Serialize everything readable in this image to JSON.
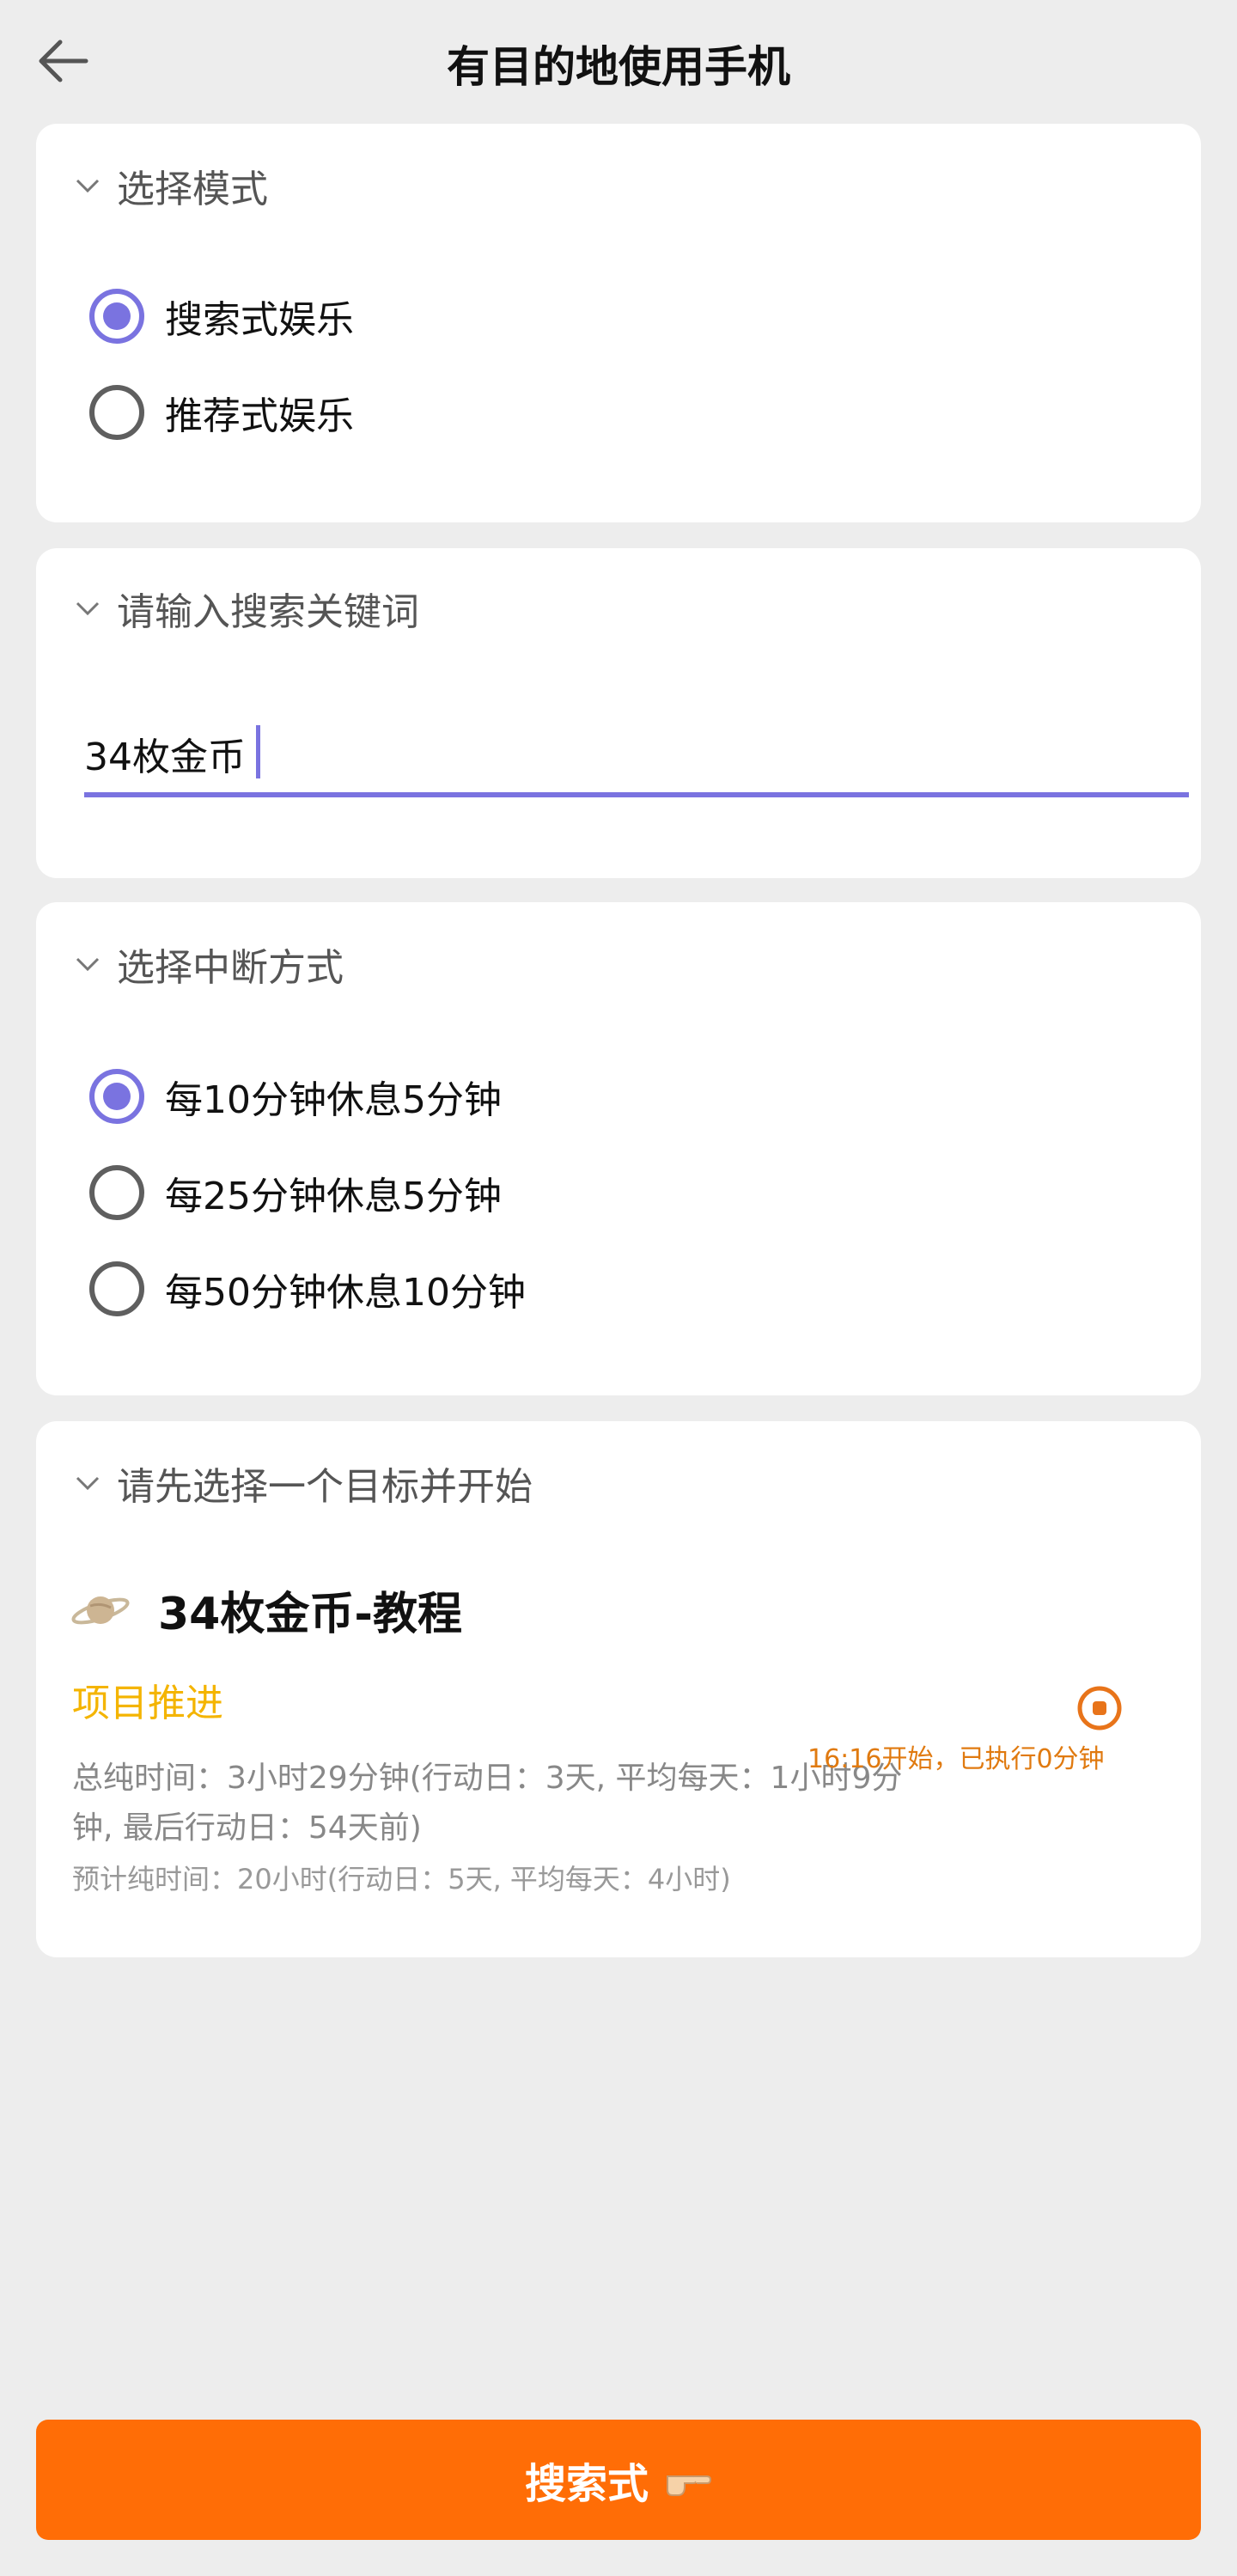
{
  "header": {
    "title": "有目的地使用手机"
  },
  "mode_section": {
    "title": "选择模式",
    "options": [
      {
        "label": "搜索式娱乐",
        "selected": true
      },
      {
        "label": "推荐式娱乐",
        "selected": false
      }
    ]
  },
  "keyword_section": {
    "title": "请输入搜索关键词",
    "value": "34枚金币",
    "placeholder": ""
  },
  "interrupt_section": {
    "title": "选择中断方式",
    "options": [
      {
        "label": "每10分钟休息5分钟",
        "selected": true
      },
      {
        "label": "每25分钟休息5分钟",
        "selected": false
      },
      {
        "label": "每50分钟休息10分钟",
        "selected": false
      }
    ]
  },
  "goal_section": {
    "title": "请先选择一个目标并开始",
    "goal_name": "34枚金币-教程",
    "goal_icon": "planet-icon",
    "project_label": "项目推进",
    "total_time_line1": "总纯时间：3小时29分钟(行动日：3天, 平均每天：1小时9分",
    "total_time_line2": "钟, 最后行动日：54天前)",
    "estimated_time": "预计纯时间：20小时(行动日：5天, 平均每天：4小时)",
    "running_status": "16:16开始，已执行0分钟"
  },
  "footer": {
    "action_label": "搜索式",
    "action_icon": "pointing-hand-icon"
  },
  "colors": {
    "accent": "#7a73e0",
    "primary_button": "#ff6d06",
    "project_label": "#f4b400",
    "running_text": "#e07a10",
    "background": "#ededed"
  }
}
